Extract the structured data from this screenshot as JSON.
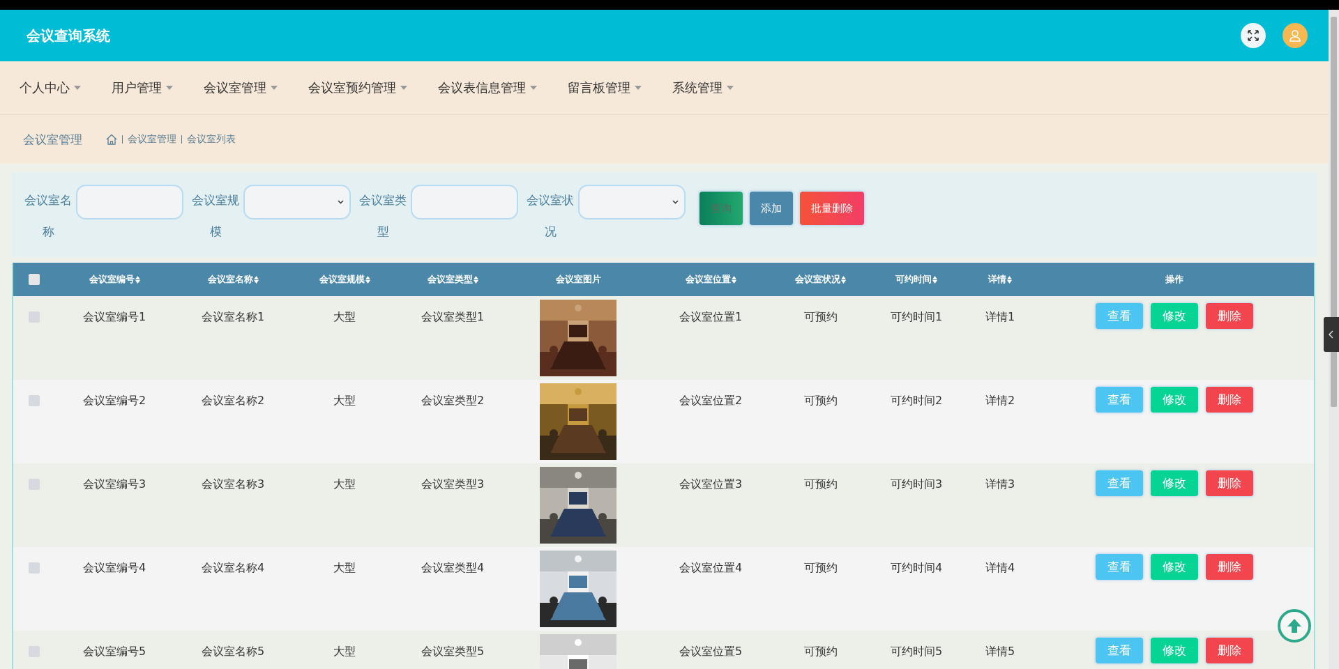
{
  "header": {
    "title": "会议查询系统"
  },
  "nav": [
    {
      "label": "个人中心"
    },
    {
      "label": "用户管理"
    },
    {
      "label": "会议室管理"
    },
    {
      "label": "会议室预约管理"
    },
    {
      "label": "会议表信息管理"
    },
    {
      "label": "留言板管理"
    },
    {
      "label": "系统管理"
    }
  ],
  "breadcrumb": {
    "title": "会议室管理",
    "path": [
      "会议室管理",
      "会议室列表"
    ]
  },
  "filters": [
    {
      "label": "会议室名称",
      "kind": "input"
    },
    {
      "label": "会议室规模",
      "kind": "select"
    },
    {
      "label": "会议室类型",
      "kind": "input"
    },
    {
      "label": "会议室状况",
      "kind": "select"
    }
  ],
  "actions": [
    {
      "label": "查询",
      "kind": "search"
    },
    {
      "label": "添加",
      "kind": "add"
    },
    {
      "label": "批量删除",
      "kind": "delete"
    }
  ],
  "table": {
    "select_all_checked": false,
    "columns": [
      {
        "label": "会议室编号",
        "sortable": true
      },
      {
        "label": "会议室名称",
        "sortable": true
      },
      {
        "label": "会议室规模",
        "sortable": true
      },
      {
        "label": "会议室类型",
        "sortable": true
      },
      {
        "label": "会议室图片",
        "sortable": false
      },
      {
        "label": "会议室位置",
        "sortable": true
      },
      {
        "label": "会议室状况",
        "sortable": true
      },
      {
        "label": "可约时间",
        "sortable": true
      },
      {
        "label": "详情",
        "sortable": true
      },
      {
        "label": "操作",
        "sortable": false
      }
    ],
    "rows": [
      {
        "checked": false,
        "cells": [
          {
            "kind": "text",
            "text": "会议室编号1"
          },
          {
            "kind": "text",
            "text": "会议室名称1"
          },
          {
            "kind": "text",
            "text": "大型"
          },
          {
            "kind": "text",
            "text": "会议室类型1"
          },
          {
            "kind": "picture"
          },
          {
            "kind": "text",
            "text": "会议室位置1"
          },
          {
            "kind": "text",
            "text": "可预约"
          },
          {
            "kind": "text",
            "text": "可约时间1"
          },
          {
            "kind": "text",
            "text": "详情1"
          }
        ],
        "buttons": [
          {
            "label": "查看",
            "kind": "view"
          },
          {
            "label": "修改",
            "kind": "edit"
          },
          {
            "label": "删除",
            "kind": "delete"
          }
        ]
      },
      {
        "checked": false,
        "cells": [
          {
            "kind": "text",
            "text": "会议室编号2"
          },
          {
            "kind": "text",
            "text": "会议室名称2"
          },
          {
            "kind": "text",
            "text": "大型"
          },
          {
            "kind": "text",
            "text": "会议室类型2"
          },
          {
            "kind": "picture"
          },
          {
            "kind": "text",
            "text": "会议室位置2"
          },
          {
            "kind": "text",
            "text": "可预约"
          },
          {
            "kind": "text",
            "text": "可约时间2"
          },
          {
            "kind": "text",
            "text": "详情2"
          }
        ],
        "buttons": [
          {
            "label": "查看",
            "kind": "view"
          },
          {
            "label": "修改",
            "kind": "edit"
          },
          {
            "label": "删除",
            "kind": "delete"
          }
        ]
      },
      {
        "checked": false,
        "cells": [
          {
            "kind": "text",
            "text": "会议室编号3"
          },
          {
            "kind": "text",
            "text": "会议室名称3"
          },
          {
            "kind": "text",
            "text": "大型"
          },
          {
            "kind": "text",
            "text": "会议室类型3"
          },
          {
            "kind": "picture"
          },
          {
            "kind": "text",
            "text": "会议室位置3"
          },
          {
            "kind": "text",
            "text": "可预约"
          },
          {
            "kind": "text",
            "text": "可约时间3"
          },
          {
            "kind": "text",
            "text": "详情3"
          }
        ],
        "buttons": [
          {
            "label": "查看",
            "kind": "view"
          },
          {
            "label": "修改",
            "kind": "edit"
          },
          {
            "label": "删除",
            "kind": "delete"
          }
        ]
      },
      {
        "checked": false,
        "cells": [
          {
            "kind": "text",
            "text": "会议室编号4"
          },
          {
            "kind": "text",
            "text": "会议室名称4"
          },
          {
            "kind": "text",
            "text": "大型"
          },
          {
            "kind": "text",
            "text": "会议室类型4"
          },
          {
            "kind": "picture"
          },
          {
            "kind": "text",
            "text": "会议室位置4"
          },
          {
            "kind": "text",
            "text": "可预约"
          },
          {
            "kind": "text",
            "text": "可约时间4"
          },
          {
            "kind": "text",
            "text": "详情4"
          }
        ],
        "buttons": [
          {
            "label": "查看",
            "kind": "view"
          },
          {
            "label": "修改",
            "kind": "edit"
          },
          {
            "label": "删除",
            "kind": "delete"
          }
        ]
      },
      {
        "checked": false,
        "cells": [
          {
            "kind": "text",
            "text": "会议室编号5"
          },
          {
            "kind": "text",
            "text": "会议室名称5"
          },
          {
            "kind": "text",
            "text": "大型"
          },
          {
            "kind": "text",
            "text": "会议室类型5"
          },
          {
            "kind": "picture"
          },
          {
            "kind": "text",
            "text": "会议室位置5"
          },
          {
            "kind": "text",
            "text": "可预约"
          },
          {
            "kind": "text",
            "text": "可约时间5"
          },
          {
            "kind": "text",
            "text": "详情5"
          }
        ],
        "buttons": [
          {
            "label": "查看",
            "kind": "view"
          },
          {
            "label": "修改",
            "kind": "edit"
          },
          {
            "label": "删除",
            "kind": "delete"
          }
        ]
      }
    ]
  }
}
